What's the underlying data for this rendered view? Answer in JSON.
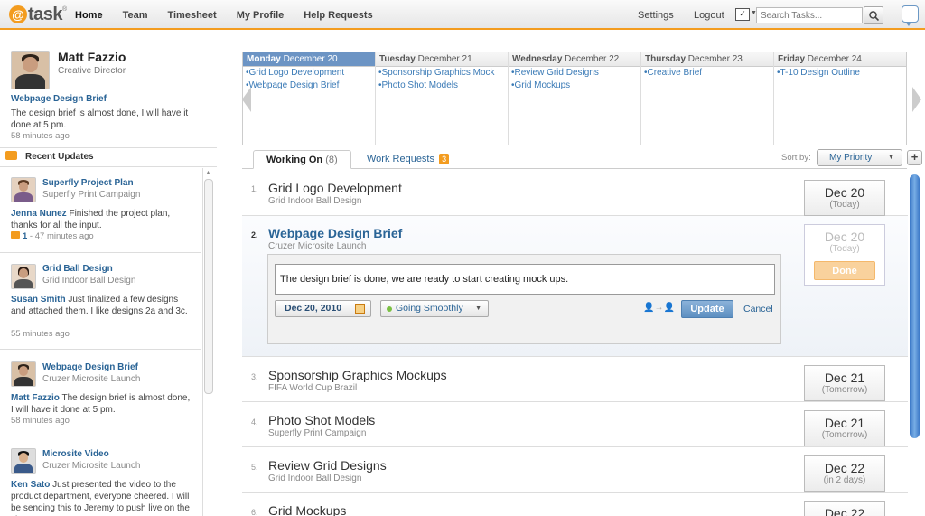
{
  "app": {
    "logo_text": "task",
    "logo_mark": "@",
    "logo_tm": "®"
  },
  "nav": {
    "items": [
      "Home",
      "Team",
      "Timesheet",
      "My Profile",
      "Help Requests"
    ],
    "active": "Home"
  },
  "topright": {
    "settings": "Settings",
    "logout": "Logout",
    "search_placeholder": "Search Tasks..."
  },
  "profile": {
    "name": "Matt Fazzio",
    "role": "Creative Director",
    "latest_link": "Webpage Design Brief",
    "latest_msg": "The design brief is almost done, I will have it done at 5 pm.",
    "latest_time": "58 minutes ago"
  },
  "recent_updates": {
    "title": "Recent Updates",
    "items": [
      {
        "task": "Superfly Project Plan",
        "project": "Superfly Print Campaign",
        "author": "Jenna Nunez",
        "text": " Finished the project plan, thanks for all the input.",
        "comments": "1",
        "time": " - 47 minutes ago"
      },
      {
        "task": "Grid Ball Design",
        "project": "Grid Indoor Ball Design",
        "author": "Susan Smith",
        "text": " Just finalized a few designs and attached them.  I like designs 2a and 3c.",
        "time": "55 minutes ago"
      },
      {
        "task": "Webpage Design Brief",
        "project": "Cruzer Microsite Launch",
        "author": "Matt Fazzio",
        "text": " The design brief is almost done, I will have it done at 5 pm.",
        "time": "58 minutes ago"
      },
      {
        "task": "Microsite Video",
        "project": "Cruzer Microsite Launch",
        "author": "Ken Sato",
        "text": " Just presented the video to the product department, everyone cheered.  I will be sending this to Jeremy to push live on the site...",
        "time": ""
      }
    ]
  },
  "calendar": {
    "days": [
      {
        "weekday": "Monday",
        "date": "December 20",
        "today": true,
        "items": [
          "•Grid Logo Development",
          "•Webpage Design Brief"
        ]
      },
      {
        "weekday": "Tuesday",
        "date": "December 21",
        "items": [
          "•Sponsorship Graphics Mock",
          "•Photo Shot Models"
        ]
      },
      {
        "weekday": "Wednesday",
        "date": "December 22",
        "items": [
          "•Review Grid Designs",
          "•Grid Mockups"
        ]
      },
      {
        "weekday": "Thursday",
        "date": "December 23",
        "items": [
          "•Creative Brief"
        ]
      },
      {
        "weekday": "Friday",
        "date": "December 24",
        "items": [
          "•T-10 Design Outline"
        ]
      }
    ]
  },
  "tabs": {
    "working_on": "Working On",
    "working_on_count": "(8)",
    "work_requests": "Work Requests",
    "work_requests_badge": "3"
  },
  "sort": {
    "label": "Sort by:",
    "value": "My Priority"
  },
  "tasks": [
    {
      "num": "1.",
      "name": "Grid Logo Development",
      "project": "Grid Indoor Ball Design",
      "date": "Dec 20",
      "rel": "(Today)"
    },
    {
      "num": "2.",
      "name": "Webpage Design Brief",
      "project": "Cruzer Microsite Launch",
      "date": "Dec 20",
      "rel": "(Today)",
      "done_label": "Done",
      "note": "The design brief is done, we are ready to start creating mock ups.",
      "due": "Dec 20, 2010",
      "status": "Going Smoothly",
      "update_label": "Update",
      "cancel_label": "Cancel"
    },
    {
      "num": "3.",
      "name": "Sponsorship Graphics Mockups",
      "project": "FIFA World Cup Brazil",
      "date": "Dec 21",
      "rel": "(Tomorrow)"
    },
    {
      "num": "4.",
      "name": "Photo Shot Models",
      "project": "Superfly Print Campaign",
      "date": "Dec 21",
      "rel": "(Tomorrow)"
    },
    {
      "num": "5.",
      "name": "Review Grid Designs",
      "project": "Grid Indoor Ball Design",
      "date": "Dec 22",
      "rel": "(in 2 days)"
    },
    {
      "num": "6.",
      "name": "Grid Mockups",
      "project": "",
      "date": "Dec 22",
      "rel": ""
    }
  ],
  "colors": {
    "accent": "#f39c1f",
    "link": "#2a6496",
    "today_header": "#6c94c4"
  }
}
